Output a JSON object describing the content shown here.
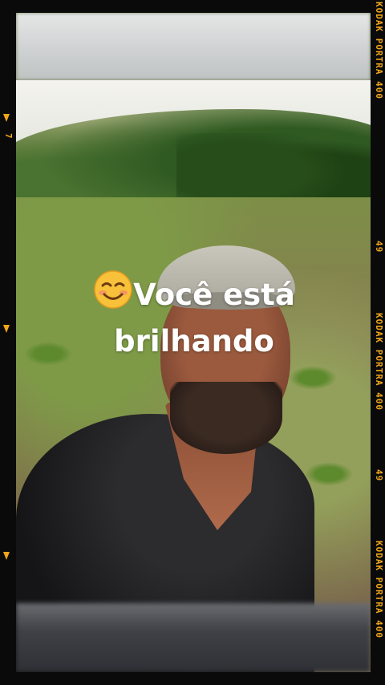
{
  "caption": {
    "line1": "Você está",
    "line2": "brilhando",
    "emoji_icon": "smiling-face-emoji"
  },
  "film_border": {
    "color": "#f0a61a",
    "right_labels": [
      "KODAK PORTRA 400",
      "49",
      "KODAK PORTRA 400",
      "49",
      "KODAK PORTRA 400"
    ],
    "left_number": "7"
  }
}
